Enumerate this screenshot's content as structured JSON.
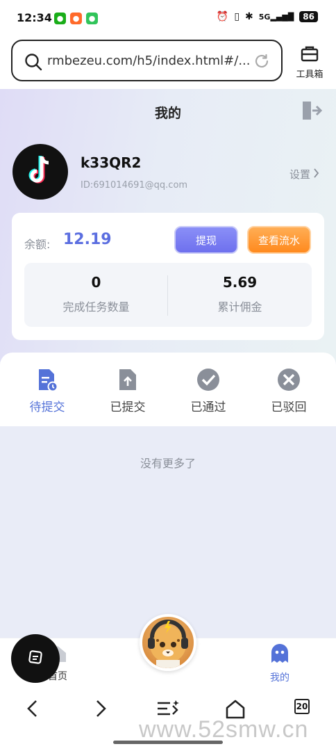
{
  "status_bar": {
    "time": "12:34",
    "network": "5G",
    "battery": "86"
  },
  "browser": {
    "url": "rmbezeu.com/h5/index.html#/...",
    "toolbox_label": "工具箱"
  },
  "header": {
    "title": "我的"
  },
  "profile": {
    "username": "k33QR2",
    "user_id": "ID:691014691@qq.com",
    "settings_label": "设置"
  },
  "balance": {
    "label": "余额:",
    "value": "12.19",
    "withdraw_label": "提现",
    "flow_label": "查看流水",
    "stats": [
      {
        "value": "0",
        "label": "完成任务数量"
      },
      {
        "value": "5.69",
        "label": "累计佣金"
      }
    ]
  },
  "tabs": [
    {
      "label": "待提交",
      "active": true
    },
    {
      "label": "已提交",
      "active": false
    },
    {
      "label": "已通过",
      "active": false
    },
    {
      "label": "已驳回",
      "active": false
    }
  ],
  "empty_message": "没有更多了",
  "app_nav": {
    "home_label": "首页",
    "me_label": "我的"
  },
  "browser_nav": {
    "tab_count": "20"
  },
  "watermark": "www.52smw.cn",
  "colors": {
    "accent": "#5472d8",
    "balance": "#5b6ee0",
    "withdraw": "#7577f0",
    "flow": "#ff9a33"
  }
}
